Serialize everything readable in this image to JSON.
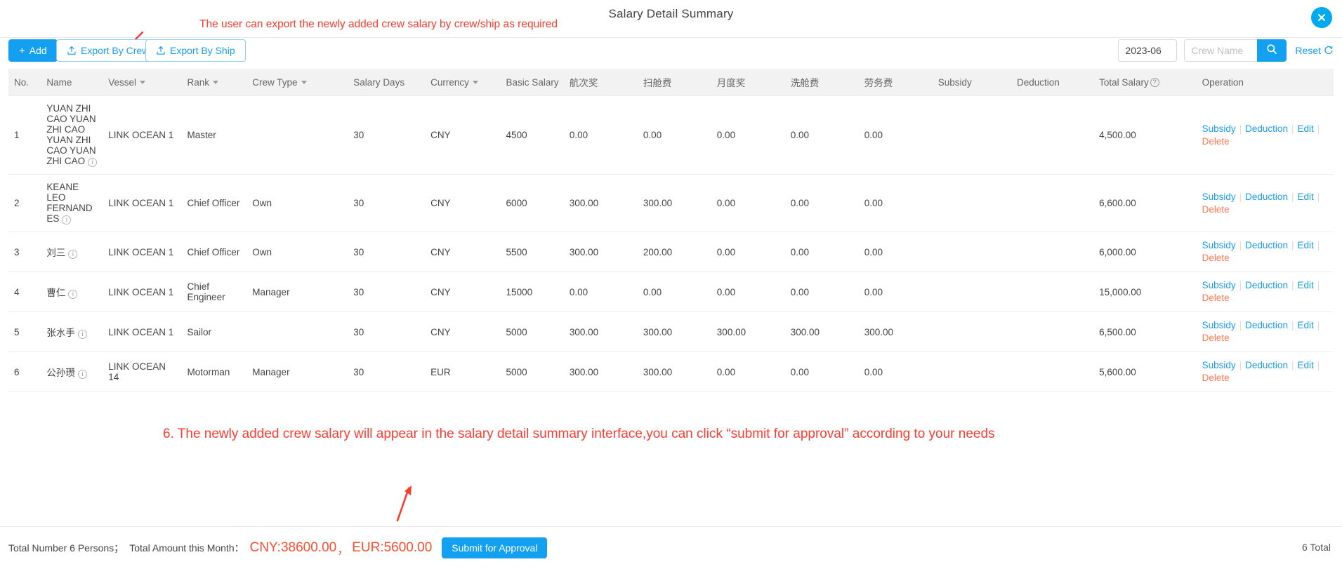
{
  "dialog": {
    "title": "Salary Detail Summary",
    "close_icon": "close-icon"
  },
  "annotations": {
    "top_note": "The user can export the newly added crew salary by crew/ship as required",
    "middle_note": "6. The newly added crew salary will appear in the salary detail summary interface,you can click “submit for approval” according to your needs"
  },
  "toolbar": {
    "add_label": "Add",
    "export_by_crew_label": "Export By Crew",
    "export_by_ship_label": "Export By Ship",
    "add_icon": "plus-icon",
    "export_icon": "upload-icon"
  },
  "filters": {
    "month_value": "2023-06",
    "crew_name_value": "",
    "crew_name_placeholder": "Crew Name",
    "search_icon": "search-icon",
    "reset_label": "Reset",
    "reset_icon": "refresh-icon"
  },
  "table": {
    "columns": [
      {
        "key": "no",
        "label": "No.",
        "sortable": false
      },
      {
        "key": "name",
        "label": "Name",
        "sortable": false
      },
      {
        "key": "vessel",
        "label": "Vessel",
        "sortable": true
      },
      {
        "key": "rank",
        "label": "Rank",
        "sortable": true
      },
      {
        "key": "crewtype",
        "label": "Crew Type",
        "sortable": true
      },
      {
        "key": "days",
        "label": "Salary Days",
        "sortable": false
      },
      {
        "key": "currency",
        "label": "Currency",
        "sortable": true
      },
      {
        "key": "basic",
        "label": "Basic Salary",
        "sortable": false
      },
      {
        "key": "f1",
        "label": "航次奖",
        "sortable": false
      },
      {
        "key": "f2",
        "label": "扫舱费",
        "sortable": false
      },
      {
        "key": "f3",
        "label": "月度奖",
        "sortable": false
      },
      {
        "key": "f4",
        "label": "洗舱费",
        "sortable": false
      },
      {
        "key": "f5",
        "label": "劳务费",
        "sortable": false
      },
      {
        "key": "subsidy",
        "label": "Subsidy",
        "sortable": false
      },
      {
        "key": "deduction",
        "label": "Deduction",
        "sortable": false
      },
      {
        "key": "total",
        "label": "Total Salary",
        "sortable": false,
        "help": true
      },
      {
        "key": "op",
        "label": "Operation",
        "sortable": false
      }
    ],
    "rows": [
      {
        "no": "1",
        "name": "YUAN ZHI CAO YUAN ZHI CAO YUAN ZHI CAO YUAN ZHI CAO",
        "vessel": "LINK OCEAN 1",
        "rank": "Master",
        "crewtype": "",
        "days": "30",
        "currency": "CNY",
        "basic": "4500",
        "f1": "0.00",
        "f2": "0.00",
        "f3": "0.00",
        "f4": "0.00",
        "f5": "0.00",
        "subsidy": "",
        "deduction": "",
        "total": "4,500.00"
      },
      {
        "no": "2",
        "name": "KEANE LEO FERNANDES",
        "vessel": "LINK OCEAN 1",
        "rank": "Chief Officer",
        "crewtype": "Own",
        "days": "30",
        "currency": "CNY",
        "basic": "6000",
        "f1": "300.00",
        "f2": "300.00",
        "f3": "0.00",
        "f4": "0.00",
        "f5": "0.00",
        "subsidy": "",
        "deduction": "",
        "total": "6,600.00"
      },
      {
        "no": "3",
        "name": "刘三",
        "vessel": "LINK OCEAN 1",
        "rank": "Chief Officer",
        "crewtype": "Own",
        "days": "30",
        "currency": "CNY",
        "basic": "5500",
        "f1": "300.00",
        "f2": "200.00",
        "f3": "0.00",
        "f4": "0.00",
        "f5": "0.00",
        "subsidy": "",
        "deduction": "",
        "total": "6,000.00"
      },
      {
        "no": "4",
        "name": "曹仁",
        "vessel": "LINK OCEAN 1",
        "rank": "Chief Engineer",
        "crewtype": "Manager",
        "days": "30",
        "currency": "CNY",
        "basic": "15000",
        "f1": "0.00",
        "f2": "0.00",
        "f3": "0.00",
        "f4": "0.00",
        "f5": "0.00",
        "subsidy": "",
        "deduction": "",
        "total": "15,000.00"
      },
      {
        "no": "5",
        "name": "张水手",
        "vessel": "LINK OCEAN 1",
        "rank": "Sailor",
        "crewtype": "",
        "days": "30",
        "currency": "CNY",
        "basic": "5000",
        "f1": "300.00",
        "f2": "300.00",
        "f3": "300.00",
        "f4": "300.00",
        "f5": "300.00",
        "subsidy": "",
        "deduction": "",
        "total": "6,500.00"
      },
      {
        "no": "6",
        "name": "公孙瓒",
        "vessel": "LINK OCEAN 14",
        "rank": "Motorman",
        "crewtype": "Manager",
        "days": "30",
        "currency": "EUR",
        "basic": "5000",
        "f1": "300.00",
        "f2": "300.00",
        "f3": "0.00",
        "f4": "0.00",
        "f5": "0.00",
        "subsidy": "",
        "deduction": "",
        "total": "5,600.00"
      }
    ],
    "operation_links": {
      "subsidy": "Subsidy",
      "deduction": "Deduction",
      "edit": "Edit",
      "delete": "Delete"
    },
    "info_icon": "info-icon"
  },
  "footer": {
    "total_number_text": "Total Number 6 Persons；",
    "total_amount_label": "Total Amount this Month：",
    "amount_cny": "CNY:38600.00",
    "amount_separator": "，",
    "amount_eur": "EUR:5600.00",
    "submit_label": "Submit for Approval",
    "total_count": "6 Total"
  },
  "colors": {
    "accent": "#14a0f0",
    "link": "#1a9cf0",
    "danger": "#ff7b54",
    "annotation": "#ff3b30",
    "amount": "#ff4d2e",
    "header_bg": "#f2f2f2"
  }
}
